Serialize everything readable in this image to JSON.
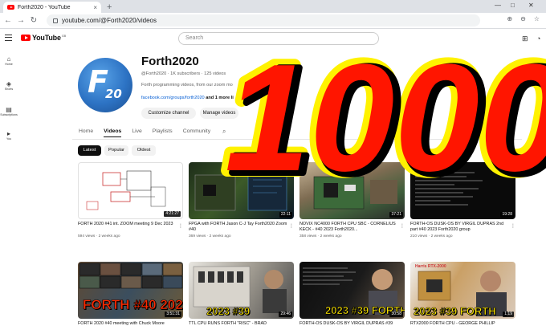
{
  "browser": {
    "tab_title": "Forth2020 - YouTube",
    "tab_close": "×",
    "new_tab": "+",
    "url": "youtube.com/@Forth2020/videos",
    "back": "←",
    "forward": "→",
    "reload": "↻"
  },
  "youtube_header": {
    "logo_text": "YouTube",
    "region": "GB",
    "search_placeholder": "Search"
  },
  "sidebar": {
    "items": [
      {
        "label": "Home",
        "icon": "home-icon",
        "glyph": "⌂"
      },
      {
        "label": "Shorts",
        "icon": "shorts-icon",
        "glyph": "◈"
      },
      {
        "label": "Subscriptions",
        "icon": "subscriptions-icon",
        "glyph": "▤"
      },
      {
        "label": "You",
        "icon": "you-icon",
        "glyph": "▸"
      }
    ]
  },
  "channel": {
    "name": "Forth2020",
    "meta": "@Forth2020 · 1K subscribers · 125 videos",
    "description": "Forth programming videos, from our zoom mo",
    "description_tail": "he Forth",
    "link": "facebook.com/groups/forth2020",
    "link_more": "and 1 more li",
    "customize_button": "Customize channel",
    "manage_button": "Manage videos",
    "avatar_letter": "F",
    "avatar_number": "20"
  },
  "tabs": [
    "Home",
    "Videos",
    "Live",
    "Playlists",
    "Community"
  ],
  "active_tab": "Videos",
  "chips": [
    "Latest",
    "Popular",
    "Oldest"
  ],
  "active_chip": "Latest",
  "overlay_text": "1000",
  "videos": [
    {
      "title": "FORTH 2020 #41 int. ZOOM meeting 9 Dec 2023",
      "meta": "594 views · 2 weeks ago",
      "duration": "4:21:27"
    },
    {
      "title": "FPGA with FORTH Jason C-J Tay Forth2020 Zoom #40",
      "meta": "369 views · 2 weeks ago",
      "duration": "22:11"
    },
    {
      "title": "NOVIX NC4000 FORTH CPU SBC - CORNELIUS KECK - #40 2023 Forth2020...",
      "meta": "358 views · 2 weeks ago",
      "duration": "37:21"
    },
    {
      "title": "FORTH-OS DUSK-OS BY VIRGIL DUPRAS 2nd part #40 2023 Forth2020 group",
      "meta": "210 views · 2 weeks ago",
      "duration": "19:28"
    },
    {
      "title": "FORTH 2020 #40 meeting with Chuck Moore",
      "duration": "3:51:31",
      "banner": "FORTH #40 2023"
    },
    {
      "title": "TTL CPU RUNS FORTH \"RISC\" - BRAD",
      "duration": "29:46",
      "banner": "2023 #39"
    },
    {
      "title": "FORTH-OS DUSK-OS BY VIRGIL DUPRAS #39",
      "duration": "30:58",
      "banner": "2023 #39 FORTH"
    },
    {
      "title": "RTX2000 FORTH CPU - GEORGE PHILLIP",
      "duration": "1:19",
      "banner": "2023 #39 FORTH",
      "tag": "Harris RTX-2000"
    }
  ]
}
